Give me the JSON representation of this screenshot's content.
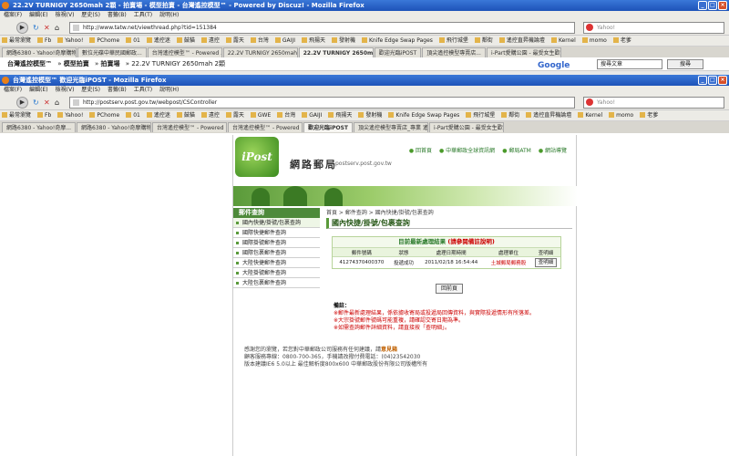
{
  "outer_window": {
    "title": "22.2V TURNIGY 2650mah 2顆 - 拍賣場 - 模型拍賣 - 台灣遙控模型™ - Powered by Discuz! - Mozilla Firefox",
    "menu": [
      "檔案(F)",
      "編輯(E)",
      "檢視(V)",
      "歷史(S)",
      "書籤(B)",
      "工具(T)",
      "說明(H)"
    ],
    "url": "http://www.tatw.net/viewthread.php?tid=151384",
    "search_placeholder": "Yahoo!",
    "bookmarks": [
      "最常瀏覽",
      "Fb",
      "Yahoo!",
      "PChome",
      "01",
      "遙控迷",
      "鼓貓",
      "遠控",
      "露天",
      "台灣",
      "GAIJI",
      "飛揚天",
      "發射機",
      "Knife Edge Swap Pages",
      "飛行城堡",
      "鄰街",
      "遙控直昇機論壇",
      "Kernel",
      "momo",
      "老爹"
    ],
    "tabs": [
      "網路6380 - Yahoo!奇摩購物...",
      "數位光碟中華民國郵政...",
      "台灣遙控模型™ - Powered ...",
      "22.2V TURNIGY 2650mah 2...",
      "22.2V TURNIGY 2650m...",
      "歡迎光臨iPOST",
      "頂尖遙控模型專賣店...",
      "i-Part愛購公園 - 最受女生歡迎..."
    ],
    "active_tab": 4,
    "breadcrumb": [
      "台灣遙控模型™",
      "模型拍賣",
      "拍賣場",
      "22.2V TURNIGY 2650mah 2顆"
    ],
    "google_label": "Google",
    "google_search_btn": "搜尋文章",
    "search_btn": "搜尋"
  },
  "inner_window": {
    "title": "台灣遙控模型™ 歡迎光臨iPOST - Mozilla Firefox",
    "menu": [
      "檔案(F)",
      "編輯(E)",
      "檢視(V)",
      "歷史(S)",
      "書籤(B)",
      "工具(T)",
      "說明(H)"
    ],
    "url": "http://postserv.post.gov.tw/webpost/CSController",
    "search_placeholder": "Yahoo!",
    "bookmarks": [
      "最常瀏覽",
      "Fb",
      "Yahoo!",
      "PChome",
      "01",
      "遙控迷",
      "鼓貓",
      "遠控",
      "露天",
      "GWE",
      "台灣",
      "GAIJI",
      "飛揚天",
      "發射機",
      "Knife Edge Swap Pages",
      "飛行城堡",
      "鄰街",
      "遙控直昇機論壇",
      "Kernel",
      "momo",
      "老爹"
    ],
    "tabs": [
      "網路6380 - Yahoo!奇摩...",
      "網路6380 - Yahoo!奇摩購物結果",
      "台灣遙控模型™ - Powered by Discuz!",
      "台灣遙控模型™ - Powered by Discuz!",
      "歡迎光臨iPOST",
      "頂尖遙控模型專賣店_專業 遙控直...",
      "i-Part愛購公園 - 最受女生歡迎的..."
    ],
    "active_tab": 4
  },
  "site": {
    "logo": "iPost",
    "name": "網路郵局",
    "url_text": "postserv.post.gov.tw",
    "top_links": [
      "回首頁",
      "中華郵政全球資訊網",
      "郵局ATM",
      "網站導覽"
    ],
    "menu_title": "郵件查詢",
    "menu_items": [
      "國內快捷/掛號/包裹查詢",
      "國際快捷郵件查詢",
      "國際掛號郵件查詢",
      "國際包裹郵件查詢",
      "大陸快捷郵件查詢",
      "大陸掛號郵件查詢",
      "大陸包裹郵件查詢"
    ],
    "crumb": "首頁 > 郵件查詢 > 國內快捷/掛號/包裹查詢",
    "page_title": "國內快捷/掛號/包裹查詢",
    "result_head": "目前最新處理結果",
    "result_head_note": "(請參閱備註說明)",
    "columns": [
      "郵件號碼",
      "狀態",
      "處理日期時間",
      "處理單位",
      "查明細"
    ],
    "rows": [
      {
        "no": "41274370400370",
        "status": "投遞成功",
        "datetime": "2011/02/18 16:54:44",
        "unit": "土城郵局郵務股",
        "detail": "查明細"
      }
    ],
    "back_btn": "回前頁",
    "notes_title": "備註：",
    "notes": [
      "※郵件最新處理結果，係依據收寄局或投遞局回傳資料，與實際投遞情形有所落差。",
      "※大宗掛號郵件號碼可能重複，請確認交寄日期為準。",
      "※如需查詢郵件詳細資料，請直接按「查明細」。"
    ],
    "footer": [
      "感謝您的瀏覽，若您對中華郵政公司服務有任何建議，請意見箱",
      "顧客服務專線：0800-700-365，手機請改撥付費電話：(04)23542030",
      "版本建議IE6 5.0以上 最佳解析度800x600 中華郵政股份有限公司版權所有"
    ],
    "footer_link": "意見箱"
  },
  "colors": {
    "accent": "#5a9a3a",
    "status_red": "#cc0000",
    "title_blue": "#1d52b8"
  }
}
